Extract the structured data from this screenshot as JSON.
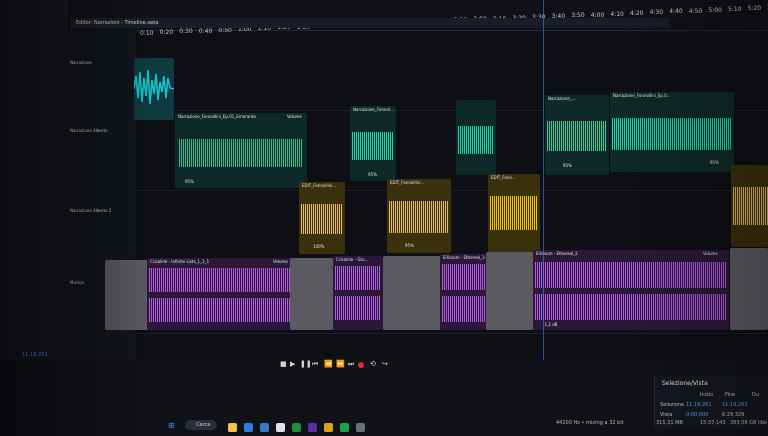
{
  "timeline": {
    "ticks": [
      "0:10",
      "0:20",
      "0:30",
      "0:40",
      "0:50",
      "1:00",
      "1:10",
      "1:20",
      "1:30",
      "1:40",
      "1:50",
      "2:00",
      "2:10",
      "2:20",
      "2:30",
      "2:40",
      "2:50",
      "3:00",
      "3:10",
      "3:20",
      "3:30",
      "3:40",
      "3:50",
      "4:00",
      "4:10",
      "4:20",
      "4:30",
      "4:40",
      "4:50",
      "5:00",
      "5:10",
      "5:20",
      "5:30"
    ]
  },
  "tab": {
    "label": "Editor: Narrazioni - Timeline.sesx"
  },
  "tracks": [
    {
      "name": "Narrazione",
      "color": "#19c0c9"
    },
    {
      "name": "Narrazione Alberto",
      "color": "#1fd5a8"
    },
    {
      "name": "Narrazione Alberto 2",
      "color": "#f0c21e"
    },
    {
      "name": "Musica",
      "color": "#b45ce8"
    }
  ],
  "clips": {
    "t2a": "Narrazione_Fonnollini_Ep.01_Emerarda",
    "t2b": "Narrazione_Fonnol...",
    "t2c": "Narrazione_Fonnollini_Ep.0...",
    "t2d": "Narrazione_...",
    "t3a": "EDIT_Fonnollini...",
    "t3b": "EDIT_Fonnollini...",
    "t3c": "EDIT_Fonn...",
    "t4a": "Crisalide - Infinite Lists_1_1_1",
    "t4b": "Crisalide - Gio...",
    "t4c": "Ellissum - Ethereal_3",
    "t4d": "Ellissum - Ethereal_2",
    "volume": "Volume",
    "p95": "95%",
    "p100": "100%",
    "db": "-1,2 dB"
  },
  "transport": {
    "icons": [
      "stop-icon",
      "play-icon",
      "pause-icon",
      "goto-start-icon",
      "rewind-icon",
      "forward-icon",
      "goto-end-icon",
      "record-icon",
      "loop-icon",
      "skip-icon"
    ]
  },
  "selection": {
    "title": "Selezione/Vista",
    "col_start": "Inizio",
    "col_end": "Fine",
    "col_dur": "Du",
    "row1_label": "Selezione",
    "row1_start": "11:19,261",
    "row1_end": "11:19,261",
    "row2_label": "Vista",
    "row2_start": "0:00,000",
    "row2_end": "6:29,329"
  },
  "status": {
    "sample": "44100 Hz • mixing a 32 bit",
    "size": "315,31 MB",
    "time": "15:37,143",
    "free": "383,08 GB libe"
  },
  "taskbar": {
    "search": "Cerca"
  },
  "left_time": "11:19:261"
}
